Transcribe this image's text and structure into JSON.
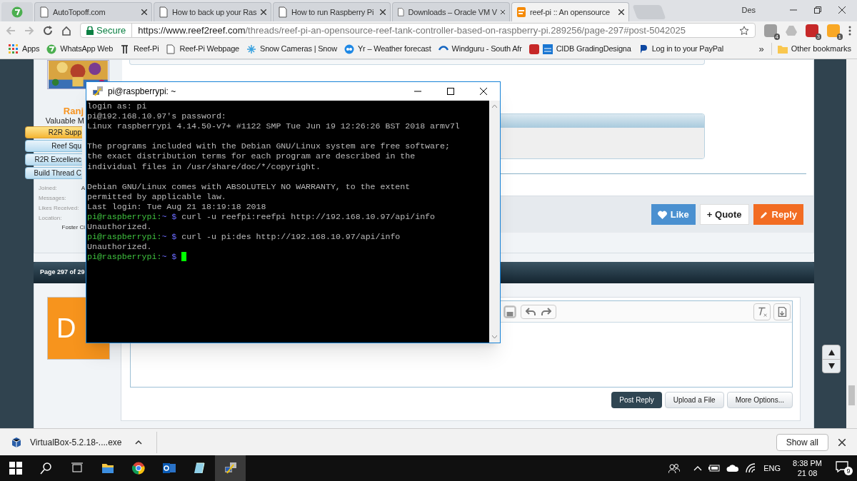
{
  "browser": {
    "tabs": [
      {
        "kind": "pinned",
        "selected": false
      },
      {
        "kind": "page",
        "title": "AutoTopoff.com",
        "selected": false
      },
      {
        "kind": "page",
        "title": "How to back up your Ras",
        "selected": false
      },
      {
        "kind": "page",
        "title": "How to run Raspberry Pi",
        "selected": false
      },
      {
        "kind": "page",
        "title": "Downloads – Oracle VM V",
        "selected": false
      },
      {
        "kind": "page",
        "title": "reef-pi :: An opensource",
        "selected": true
      }
    ],
    "profile": "Des",
    "address": {
      "secure_label": "Secure",
      "url_host": "https://www.reef2reef.com",
      "url_path": "/threads/reef-pi-an-opensource-reef-tank-controller-based-on-raspberry-pi.289256/page-297#post-5042025"
    },
    "extension_badges": [
      "4",
      "3",
      "1"
    ],
    "bookmarks": [
      "Apps",
      "WhatsApp Web",
      "Reef-Pi",
      "Reef-Pi Webpage",
      "Snow Cameras | Snow",
      "Yr – Weather forecast",
      "Windguru - South Afr",
      "CIDB GradingDesigna",
      "Log in to your PayPal"
    ],
    "bookmarks_overflow": "»",
    "other_bookmarks": "Other bookmarks"
  },
  "post": {
    "author": "Ranj",
    "author_title": "Valuable M",
    "badges": [
      {
        "label": "R2R Supp",
        "kind": "gold"
      },
      {
        "label": "Reef Squ",
        "kind": "blue"
      },
      {
        "label": "R2R Excellenc",
        "kind": "blue"
      },
      {
        "label": "Build Thread C",
        "kind": "blue"
      }
    ],
    "stats": [
      {
        "label": "Joined:",
        "value": "A"
      },
      {
        "label": "Messages:"
      },
      {
        "label": "Likes Received:"
      },
      {
        "label": "Location:"
      }
    ],
    "location_value": "Foster Ci",
    "actions": [
      {
        "kind": "like",
        "label": "Like"
      },
      {
        "kind": "quote",
        "label": "+ Quote"
      },
      {
        "kind": "reply",
        "label": "Reply"
      }
    ]
  },
  "page_nav": "Page 297 of 29",
  "reply": {
    "avatar_initials": "D",
    "buttons": [
      {
        "label": "Post Reply",
        "kind": "primary"
      },
      {
        "label": "Upload a File",
        "kind": "secondary"
      },
      {
        "label": "More Options...",
        "kind": "secondary"
      }
    ]
  },
  "terminal": {
    "title": "pi@raspberrypi: ~",
    "lines": [
      {
        "kind": "text",
        "text": "login as: pi"
      },
      {
        "kind": "text",
        "text": "pi@192.168.10.97's password:"
      },
      {
        "kind": "text",
        "text": "Linux raspberrypi 4.14.50-v7+ #1122 SMP Tue Jun 19 12:26:26 BST 2018 armv7l"
      },
      {
        "kind": "blank"
      },
      {
        "kind": "text",
        "text": "The programs included with the Debian GNU/Linux system are free software;"
      },
      {
        "kind": "text",
        "text": "the exact distribution terms for each program are described in the"
      },
      {
        "kind": "text",
        "text": "individual files in /usr/share/doc/*/copyright."
      },
      {
        "kind": "blank"
      },
      {
        "kind": "text",
        "text": "Debian GNU/Linux comes with ABSOLUTELY NO WARRANTY, to the extent"
      },
      {
        "kind": "text",
        "text": "permitted by applicable law."
      },
      {
        "kind": "text",
        "text": "Last login: Tue Aug 21 18:19:18 2018"
      },
      {
        "kind": "prompt",
        "user": "pi@raspberrypi:",
        "path": "~ $",
        "command": "curl -u reefpi:reefpi http://192.168.10.97/api/info"
      },
      {
        "kind": "text",
        "text": "Unauthorized."
      },
      {
        "kind": "prompt",
        "user": "pi@raspberrypi:",
        "path": "~ $",
        "command": "curl -u pi:des http://192.168.10.97/api/info"
      },
      {
        "kind": "text",
        "text": "Unauthorized."
      },
      {
        "kind": "prompt",
        "user": "pi@raspberrypi:",
        "path": "~ $",
        "cursor": true
      }
    ]
  },
  "downloads": {
    "file": "VirtualBox-5.2.18-....exe",
    "show_all": "Show all"
  },
  "taskbar": {
    "language": "ENG",
    "time": "8:38 PM",
    "date": "21 08",
    "notifications": "9"
  }
}
